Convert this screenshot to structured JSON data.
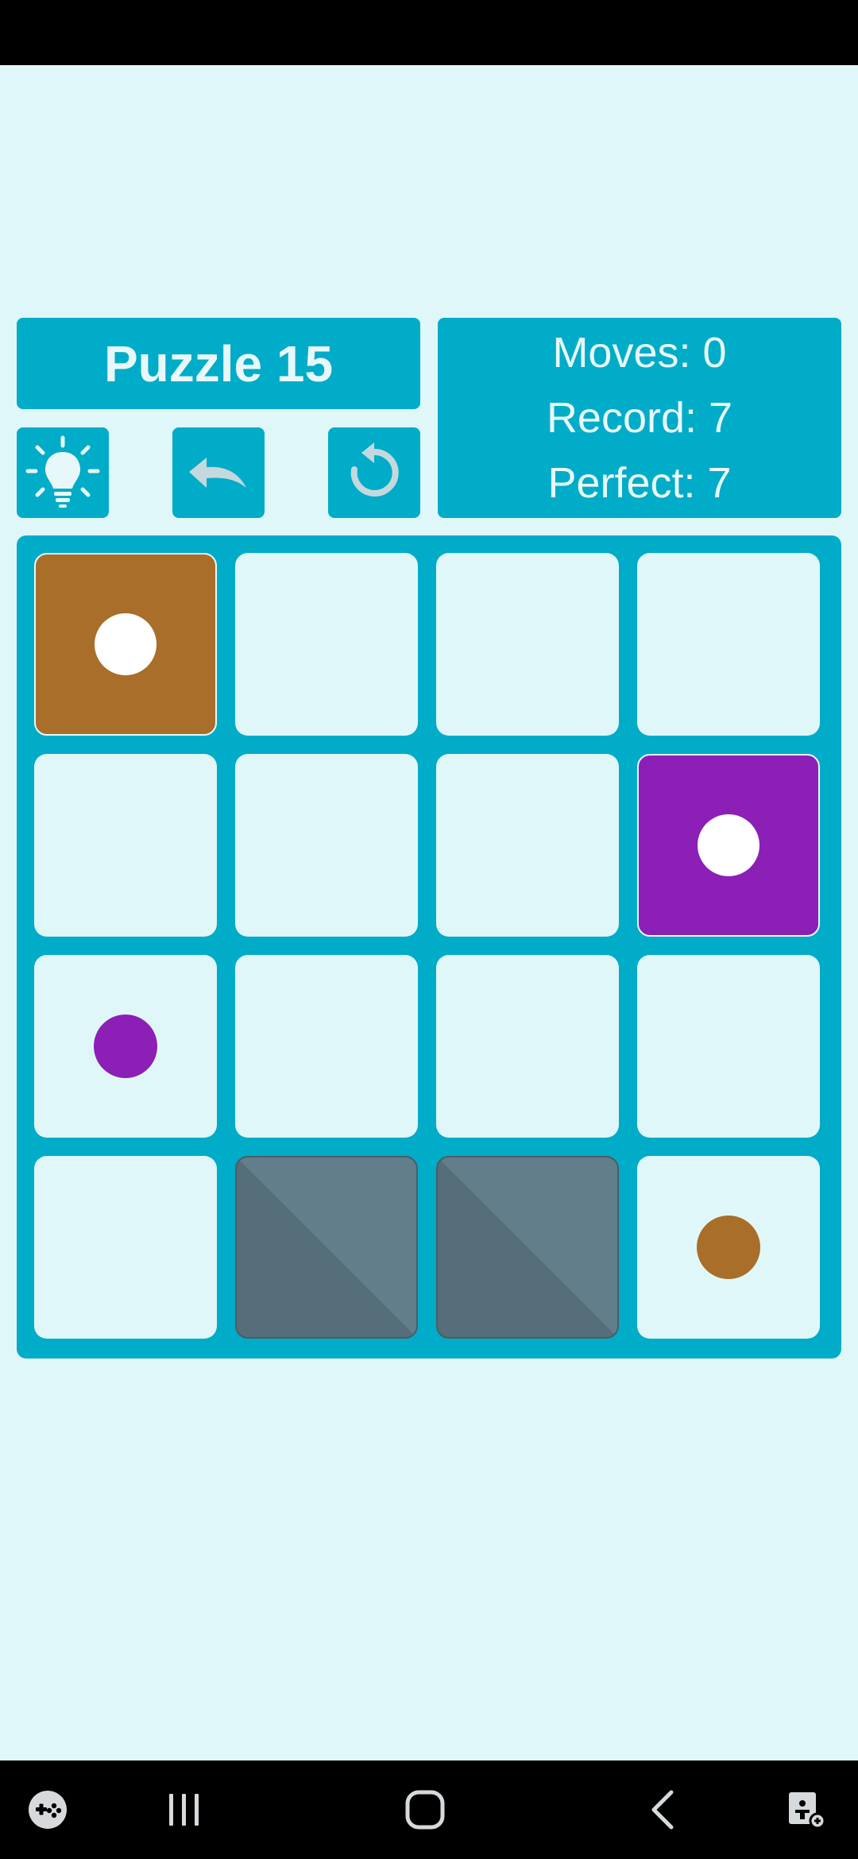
{
  "header": {
    "title": "Puzzle 15",
    "moves": "Moves: 0",
    "record": "Record: 7",
    "perfect": "Perfect: 7"
  },
  "controls": [
    "hint-bulb-icon",
    "undo-arrow-icon",
    "restart-icon"
  ],
  "colors": {
    "accent": "#00acc8",
    "background": "#e0f7f9",
    "brown": "#a86e2a",
    "purple": "#8b1fb6",
    "blocked_dark": "#566d7a",
    "blocked_light": "#637e8b"
  },
  "board": {
    "rows": 4,
    "cols": 4,
    "cells": [
      [
        "brown-block",
        "empty",
        "empty",
        "empty"
      ],
      [
        "empty",
        "empty",
        "empty",
        "purple-block"
      ],
      [
        "purple-target",
        "empty",
        "empty",
        "empty"
      ],
      [
        "empty",
        "wall",
        "wall",
        "brown-target"
      ]
    ]
  },
  "nav": [
    "game-launcher-icon",
    "recent-apps-icon",
    "home-icon",
    "back-icon",
    "accessibility-icon"
  ]
}
